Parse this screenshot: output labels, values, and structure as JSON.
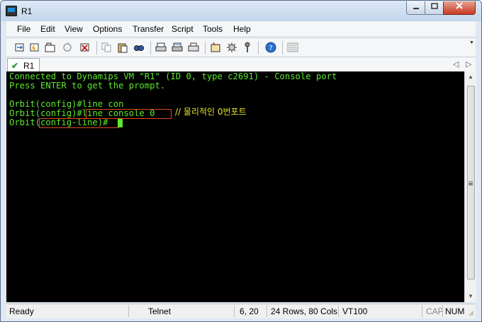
{
  "window": {
    "title": "R1"
  },
  "menu": [
    "File",
    "Edit",
    "View",
    "Options",
    "Transfer",
    "Script",
    "Tools",
    "Help"
  ],
  "tabs": [
    {
      "label": "R1"
    }
  ],
  "terminal": {
    "lines": [
      "Connected to Dynamips VM \"R1\" (ID 0, type c2691) - Console port",
      "Press ENTER to get the prompt.",
      "",
      "Orbit(config)#line con",
      "Orbit(config)#line console 0",
      "Orbit(config-line)#"
    ],
    "annotation": "// 물리적인 0번포트",
    "colors": {
      "background": "#000000",
      "text": "#5ce92b",
      "annotation": "#e8e32c",
      "highlight": "#e0491d"
    }
  },
  "statusbar": {
    "ready": "Ready",
    "protocol": "Telnet",
    "cursor_pos": "6, 20",
    "size": "24 Rows, 80 Cols",
    "emulation": "VT100",
    "cap": "CAP",
    "num": "NUM"
  }
}
